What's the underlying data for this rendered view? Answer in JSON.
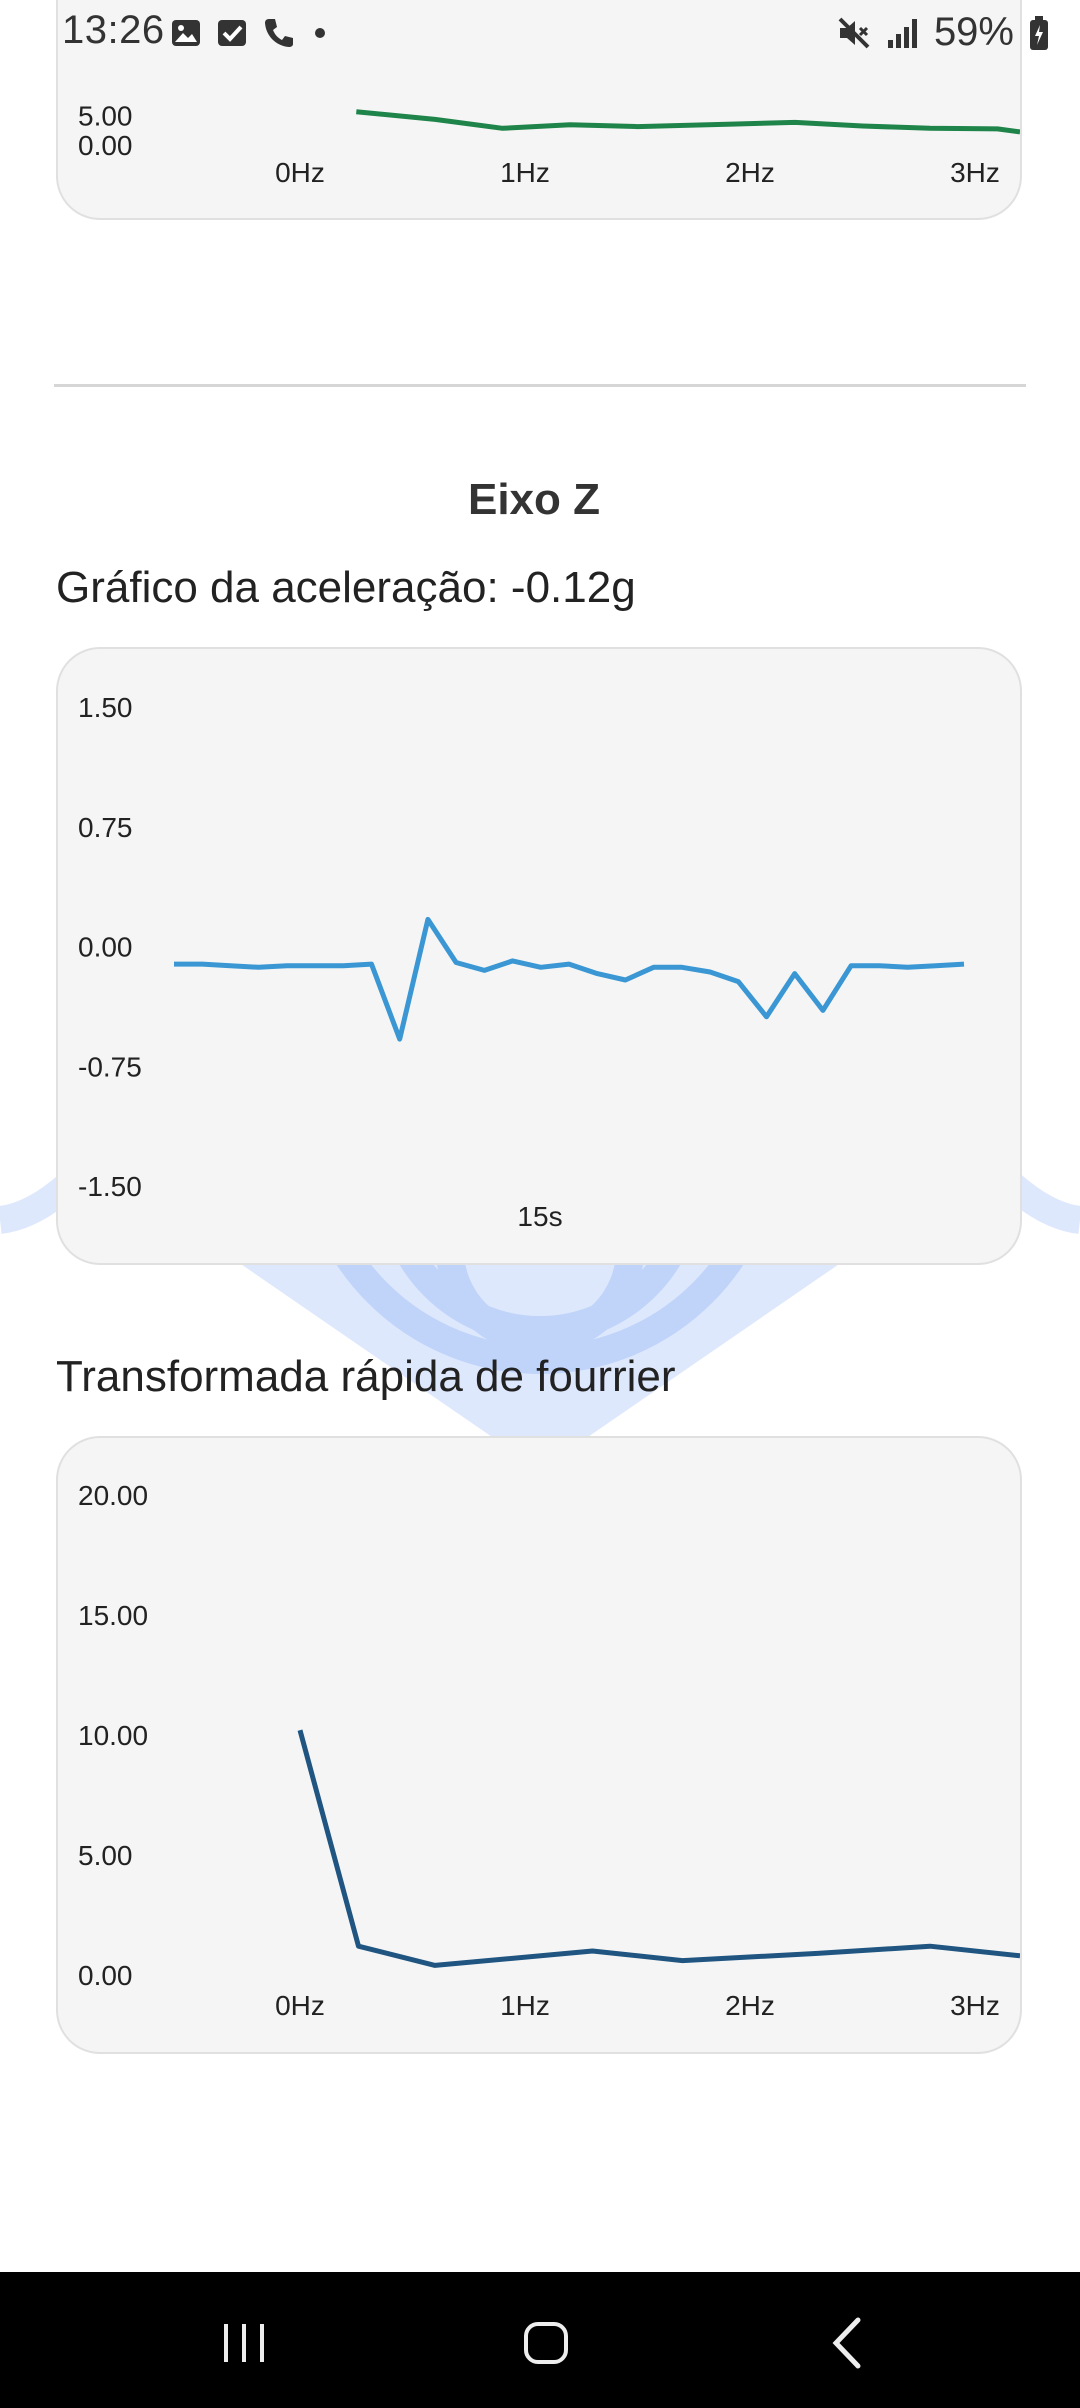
{
  "status_bar": {
    "time": "13:26",
    "battery": "59%",
    "left_icons": [
      "image-icon",
      "check-square-icon",
      "phone-icon",
      "dot-icon"
    ],
    "right_icons": [
      "mute-icon",
      "signal-icon",
      "battery-icon"
    ]
  },
  "top_chart": {
    "chart_data": {
      "type": "line",
      "color": "#1e8449",
      "y_ticks": [
        "5.00",
        "0.00"
      ],
      "x_ticks": [
        "0Hz",
        "1Hz",
        "2Hz",
        "3Hz"
      ],
      "ylim": [
        0,
        20
      ],
      "x": [
        0.25,
        0.6,
        0.9,
        1.2,
        1.5,
        1.9,
        2.2,
        2.5,
        2.8,
        3.1,
        3.2
      ],
      "values": [
        5.6,
        4.3,
        2.8,
        3.4,
        3.1,
        3.5,
        3.8,
        3.2,
        2.8,
        2.7,
        2.2
      ]
    }
  },
  "section": {
    "title": "Eixo Z",
    "accel_label": "Gráfico da aceleração: -0.12g",
    "fft_label": "Transformada rápida de fourrier"
  },
  "accel_chart": {
    "chart_data": {
      "type": "line",
      "color": "#3a97d4",
      "y_ticks": [
        "1.50",
        "0.75",
        "0.00",
        "-0.75",
        "-1.50"
      ],
      "x_tick_label": "15s",
      "ylim": [
        -1.5,
        1.5
      ],
      "values": [
        -0.11,
        -0.11,
        -0.12,
        -0.13,
        -0.12,
        -0.12,
        -0.12,
        -0.11,
        -0.58,
        0.17,
        -0.1,
        -0.15,
        -0.09,
        -0.13,
        -0.11,
        -0.17,
        -0.21,
        -0.13,
        -0.13,
        -0.16,
        -0.22,
        -0.44,
        -0.17,
        -0.4,
        -0.12,
        -0.12,
        -0.13,
        -0.12,
        -0.11
      ]
    }
  },
  "fft_chart": {
    "chart_data": {
      "type": "line",
      "color": "#1f5580",
      "y_ticks": [
        "20.00",
        "15.00",
        "10.00",
        "5.00",
        "0.00"
      ],
      "x_ticks": [
        "0Hz",
        "1Hz",
        "2Hz",
        "3Hz"
      ],
      "ylim": [
        0,
        20
      ],
      "x": [
        0.0,
        0.26,
        0.6,
        1.3,
        1.7,
        2.3,
        2.8,
        3.2
      ],
      "values": [
        10.2,
        1.2,
        0.4,
        1.0,
        0.6,
        0.9,
        1.2,
        0.8
      ]
    }
  },
  "nav_bar": {
    "buttons": [
      "recent-apps-icon",
      "home-icon",
      "back-icon"
    ]
  }
}
